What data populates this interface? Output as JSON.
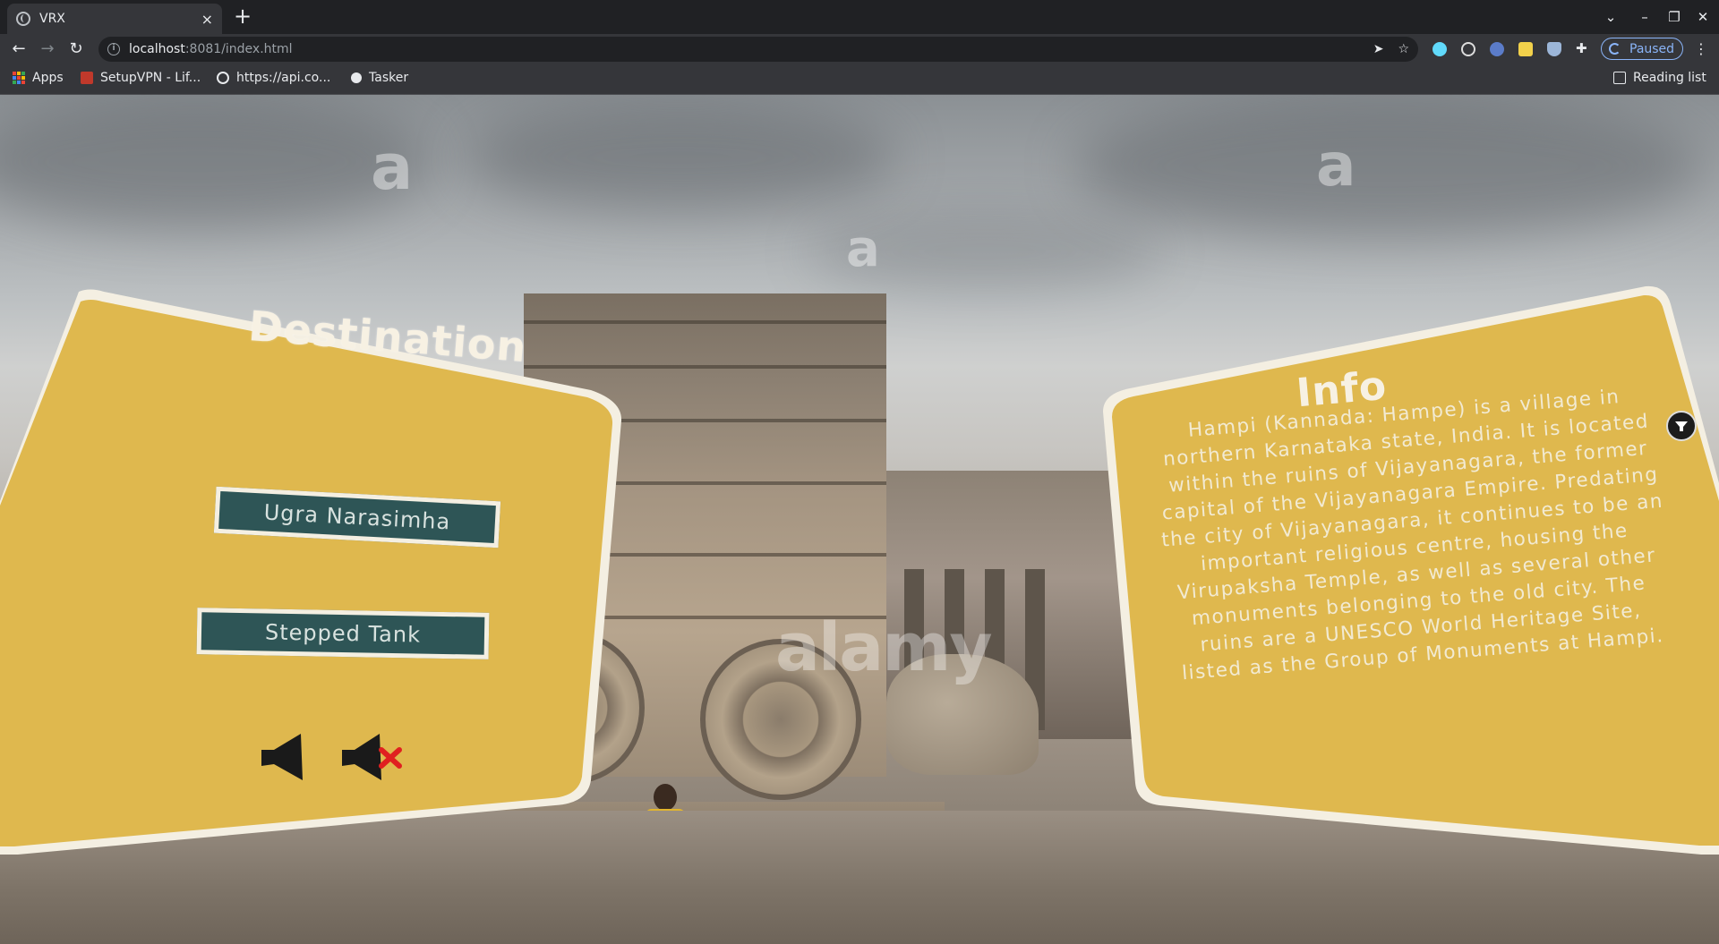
{
  "browser": {
    "tab_title": "VRX",
    "tab_close": "×",
    "new_tab": "+",
    "url_host": "localhost",
    "url_rest": ":8081/index.html",
    "profile_status": "Paused",
    "bookmarks": [
      {
        "label": "Apps",
        "icon": "apps-grid-icon"
      },
      {
        "label": "SetupVPN - Lif...",
        "icon": "vpn-icon"
      },
      {
        "label": "https://api.co...",
        "icon": "globe-icon"
      },
      {
        "label": "Tasker",
        "icon": "tasker-icon"
      }
    ],
    "reading_list": "Reading list"
  },
  "destination_panel": {
    "title": "Destination",
    "buttons": [
      "Ugra Narasimha",
      "Stepped Tank"
    ],
    "audio_on_icon": "speaker-icon",
    "audio_off_icon": "speaker-muted-icon"
  },
  "info_panel": {
    "title": "Info",
    "lines": [
      "Hampi (Kannada: Hampe) is a village in",
      "northern Karnataka state, India. It is located",
      "within the ruins of Vijayanagara, the former",
      "capital of the Vijayanagara Empire. Predating",
      "the city of Vijayanagara, it continues to be an",
      "important religious centre, housing the",
      "Virupaksha Temple, as well as several other",
      "monuments belonging to the old city. The",
      "ruins are a UNESCO World Heritage Site,",
      "listed as the Group of Monuments at Hampi."
    ]
  },
  "watermark": {
    "letter": "a",
    "brand": "alamy"
  },
  "colors": {
    "panel_gold": "#dbaf35",
    "panel_border": "#f4efe2",
    "button_teal": "#2e5556",
    "mute_red": "#e02020"
  }
}
